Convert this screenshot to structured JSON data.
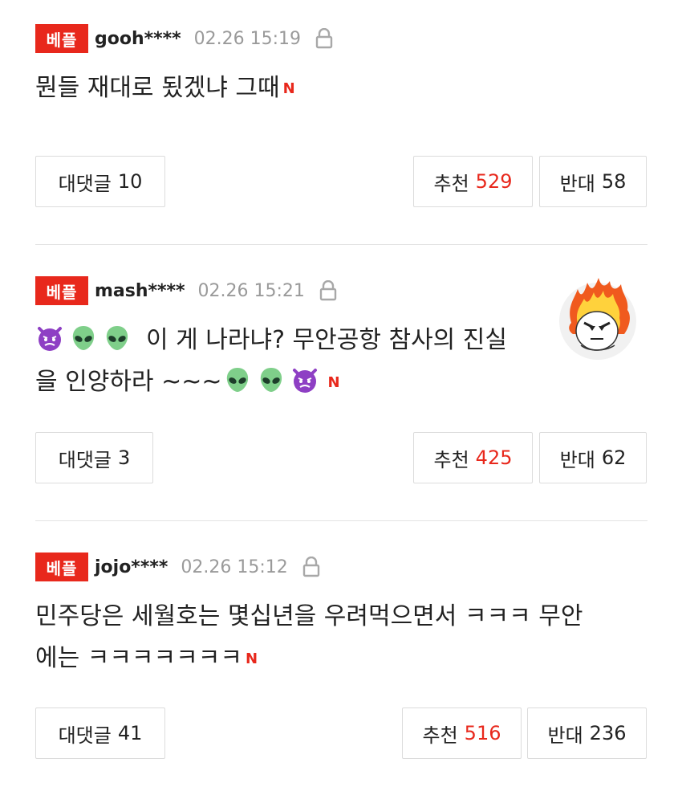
{
  "comments": [
    {
      "badge": "베플",
      "user": "gooh****",
      "time": "02.26 15:19",
      "lines": [
        "뭔들 재대로 됬겠냐 그때"
      ],
      "new_mark": "N",
      "reply_label": "대댓글",
      "reply_count": "10",
      "up_label": "추천",
      "up_count": "529",
      "down_label": "반대",
      "down_count": "58"
    },
    {
      "badge": "베플",
      "user": "mash****",
      "time": "02.26 15:21",
      "line1": "이 게 나라냐? 무안공항 참사의 진실",
      "line2": "을 인양하라 ~~~",
      "new_mark": "N",
      "emoji_line1": [
        "devil-emoji",
        "alien-emoji",
        "alien-emoji"
      ],
      "emoji_line2": [
        "alien-emoji",
        "alien-emoji",
        "devil-emoji"
      ],
      "reply_label": "대댓글",
      "reply_count": "3",
      "up_label": "추천",
      "up_count": "425",
      "down_label": "반대",
      "down_count": "62"
    },
    {
      "badge": "베플",
      "user": "jojo****",
      "time": "02.26 15:12",
      "line1": "민주당은 세월호는 몇십년을 우려먹으면서 ㅋㅋㅋ 무안",
      "line2": "에는 ㅋㅋㅋㅋㅋㅋㅋ",
      "new_mark": "N",
      "reply_label": "대댓글",
      "reply_count": "41",
      "up_label": "추천",
      "up_count": "516",
      "down_label": "반대",
      "down_count": "236"
    }
  ],
  "colors": {
    "accent": "#e8281c",
    "muted": "#9a9a9a",
    "border": "#dcdcdc"
  }
}
